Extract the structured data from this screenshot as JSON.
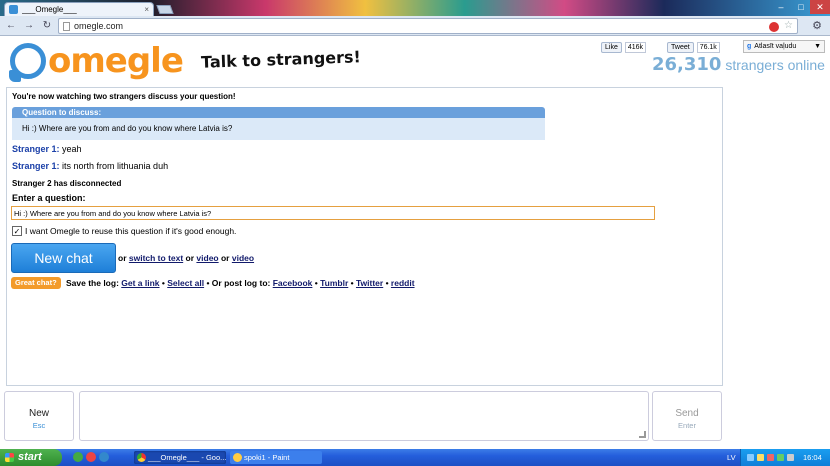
{
  "browser": {
    "tab_title": "___Omegle___",
    "tab_close": "×",
    "url": "omegle.com",
    "back": "←",
    "forward": "→",
    "reload": "↻",
    "star": "☆",
    "wrench": "⚙",
    "win_min": "–",
    "win_max": "□",
    "win_close": "✕"
  },
  "header": {
    "logo_text": "omegle",
    "tagline": "Talk to strangers!",
    "fb_like": "Like",
    "fb_count": "416k",
    "tweet": "Tweet",
    "tweet_count": "76.1k",
    "gplus": "Atlasīt vaļudu",
    "gplus_arrow": "▼",
    "online_count": "26,310",
    "online_label": "strangers online"
  },
  "log": {
    "watching": "You're now watching two strangers discuss your question!",
    "question_header": "Question to discuss:",
    "question_text": "Hi :) Where are you from and do you know where Latvia is?",
    "messages": [
      {
        "who": "Stranger 1:",
        "text": " yeah"
      },
      {
        "who": "Stranger 1:",
        "text": " its north from lithuania duh"
      }
    ],
    "disconnect": "Stranger 2 has disconnected",
    "enter_question": "Enter a question:",
    "question_input": "Hi :) Where are you from and do you know where Latvia is?",
    "reuse_label": "I want Omegle to reuse this question if it's good enough.",
    "checkmark": "✓",
    "new_chat": "New chat",
    "or1": " or ",
    "switch_text": "switch to text",
    "or2": " or ",
    "video1": "video",
    "or3": " or ",
    "video2": "video",
    "great_chat": "Great chat?",
    "save_log": "Save the log: ",
    "get_link": "Get a link",
    "sep1": " • ",
    "select_all": "Select all",
    "post_log": " • Or post log to: ",
    "facebook": "Facebook",
    "sep2": " • ",
    "tumblr": "Tumblr",
    "sep3": " • ",
    "twitter": "Twitter",
    "sep4": " • ",
    "reddit": "reddit"
  },
  "compose": {
    "new_label": "New",
    "new_hint": "Esc",
    "send_label": "Send",
    "send_hint": "Enter"
  },
  "taskbar": {
    "start": "start",
    "items": [
      "___Omegle___ - Goo...",
      "spoki1 - Paint"
    ],
    "lang": "LV",
    "clock": "16:04"
  }
}
